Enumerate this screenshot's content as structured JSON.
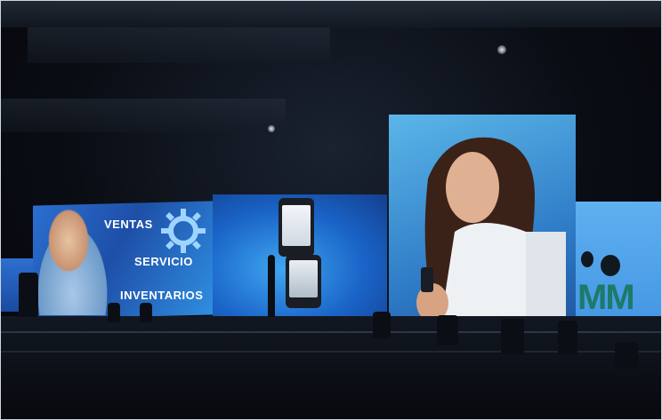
{
  "screen_left": {
    "items": [
      {
        "label": "VENTAS"
      },
      {
        "label": "SERVICIO"
      },
      {
        "label": "INVENTARIOS"
      }
    ],
    "icon": "gear-icon"
  },
  "screen_right": {
    "logo_text": "MM"
  },
  "colors": {
    "screen_blue": "#2a6fcf",
    "logo_green": "#1c7a68",
    "background": "#0a0d14"
  }
}
